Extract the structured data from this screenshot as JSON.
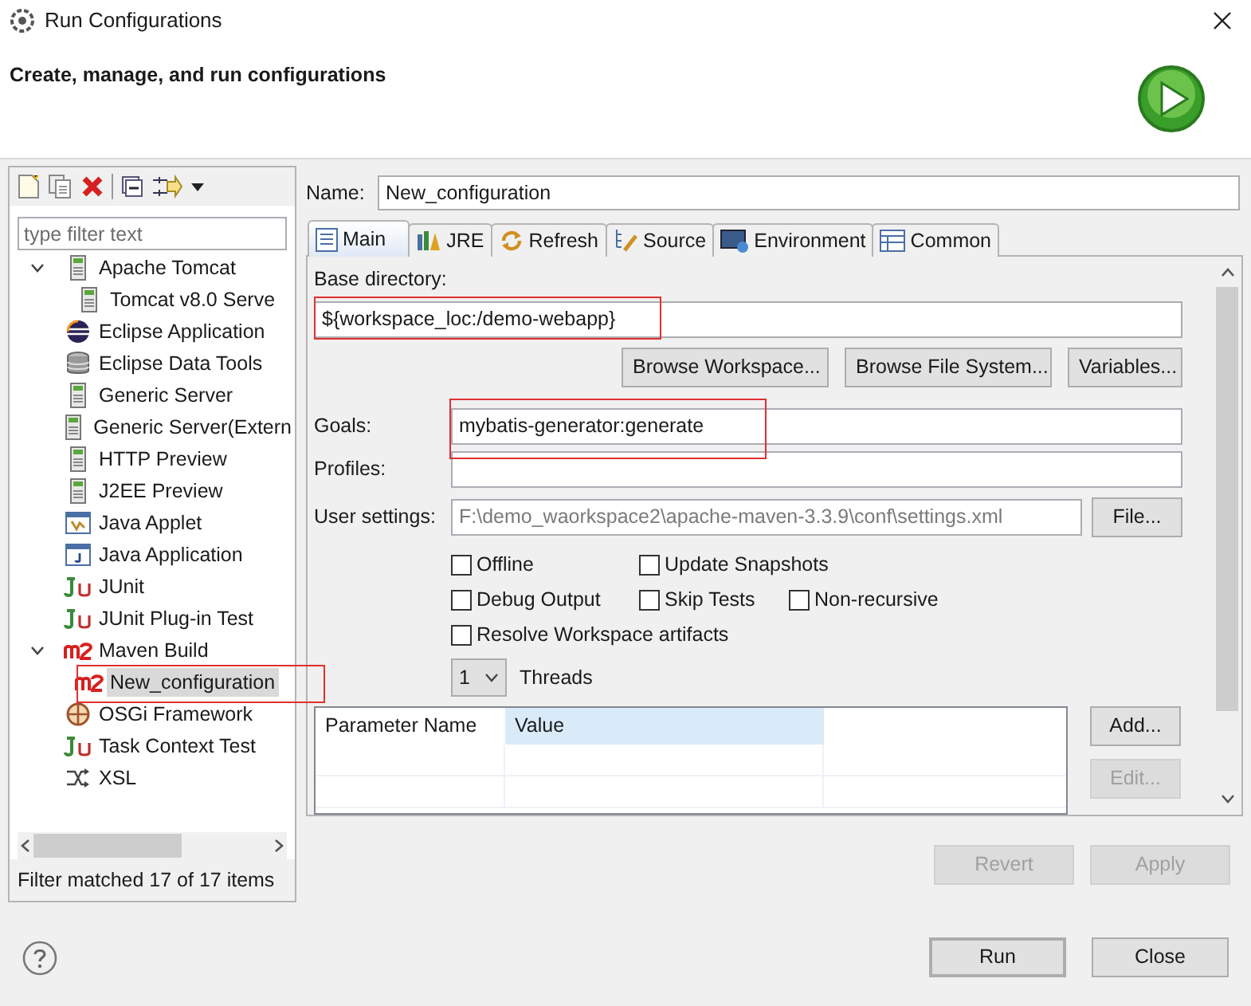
{
  "window": {
    "title": "Run Configurations"
  },
  "header": {
    "title": "Create, manage, and run configurations"
  },
  "filter": {
    "placeholder": "type filter text"
  },
  "tree": [
    {
      "label": "Apache Tomcat",
      "kind": "server",
      "expanded": true,
      "selected": false,
      "children": [
        {
          "label": "Tomcat v8.0 Serve",
          "kind": "server",
          "selected": false
        }
      ]
    },
    {
      "label": "Eclipse Application",
      "kind": "eclipse",
      "selected": false
    },
    {
      "label": "Eclipse Data Tools",
      "kind": "database",
      "selected": false
    },
    {
      "label": "Generic Server",
      "kind": "server",
      "selected": false
    },
    {
      "label": "Generic Server(Extern",
      "kind": "server",
      "selected": false
    },
    {
      "label": "HTTP Preview",
      "kind": "server",
      "selected": false
    },
    {
      "label": "J2EE Preview",
      "kind": "server",
      "selected": false
    },
    {
      "label": "Java Applet",
      "kind": "applet",
      "selected": false
    },
    {
      "label": "Java Application",
      "kind": "java",
      "selected": false
    },
    {
      "label": "JUnit",
      "kind": "junit",
      "selected": false
    },
    {
      "label": "JUnit Plug-in Test",
      "kind": "junit",
      "selected": false
    },
    {
      "label": "Maven Build",
      "kind": "maven",
      "expanded": true,
      "selected": false,
      "children": [
        {
          "label": "New_configuration",
          "kind": "maven",
          "selected": true
        }
      ]
    },
    {
      "label": "OSGi Framework",
      "kind": "osgi",
      "selected": false
    },
    {
      "label": "Task Context Test",
      "kind": "junit",
      "selected": false
    },
    {
      "label": "XSL",
      "kind": "xsl",
      "selected": false
    }
  ],
  "filter_status": "Filter matched 17 of 17 items",
  "name": {
    "label": "Name:",
    "value": "New_configuration"
  },
  "tabs": [
    {
      "label": "Main",
      "kind": "main",
      "selected": true
    },
    {
      "label": "JRE",
      "kind": "jre",
      "selected": false
    },
    {
      "label": "Refresh",
      "kind": "refresh",
      "selected": false
    },
    {
      "label": "Source",
      "kind": "source",
      "selected": false
    },
    {
      "label": "Environment",
      "kind": "environment",
      "selected": false
    },
    {
      "label": "Common",
      "kind": "common",
      "selected": false
    }
  ],
  "main": {
    "base_directory": {
      "label": "Base directory:",
      "value": "${workspace_loc:/demo-webapp}"
    },
    "browse_buttons": [
      "Browse Workspace...",
      "Browse File System...",
      "Variables..."
    ],
    "goals": {
      "label": "Goals:",
      "value": "mybatis-generator:generate"
    },
    "profiles": {
      "label": "Profiles:"
    },
    "user_settings": {
      "label": "User settings:",
      "value": "F:\\demo_waorkspace2\\apache-maven-3.3.9\\conf\\settings.xml",
      "disabled": true,
      "button": "File..."
    },
    "option_rows": [
      {
        "items": [
          {
            "label": "Offline",
            "checked": false
          },
          {
            "label": "Update Snapshots",
            "checked": false
          }
        ]
      },
      {
        "items": [
          {
            "label": "Debug Output",
            "checked": false
          },
          {
            "label": "Skip Tests",
            "checked": false
          },
          {
            "label": "Non-recursive",
            "checked": false
          }
        ]
      },
      {
        "items": [
          {
            "label": "Resolve Workspace artifacts",
            "checked": false
          }
        ]
      }
    ],
    "threads": {
      "value": "1",
      "label": "Threads"
    },
    "parameters": {
      "columns": [
        {
          "label": "Parameter Name",
          "highlighted": false
        },
        {
          "label": "Value",
          "highlighted": true
        }
      ],
      "buttons": [
        {
          "label": "Add...",
          "disabled": false
        },
        {
          "label": "Edit...",
          "disabled": true
        }
      ]
    }
  },
  "actions": [
    {
      "label": "Revert",
      "disabled": true
    },
    {
      "label": "Apply",
      "disabled": true
    }
  ],
  "buttons": [
    {
      "label": "Run",
      "default": true
    },
    {
      "label": "Close",
      "default": false
    }
  ]
}
